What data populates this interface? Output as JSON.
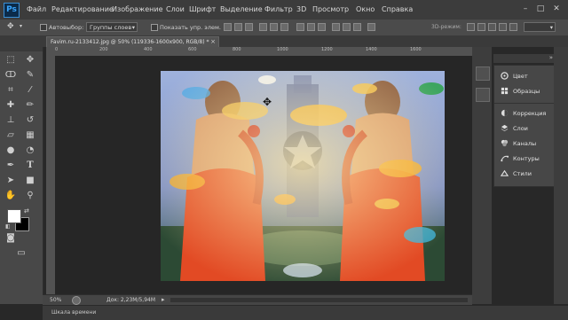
{
  "app": {
    "logo": "Ps",
    "menu": [
      "Файл",
      "Редактирование",
      "Изображение",
      "Слои",
      "Шрифт",
      "Выделение",
      "Фильтр",
      "3D",
      "Просмотр",
      "Окно",
      "Справка"
    ],
    "window_controls": [
      "minimize-icon",
      "maximize-icon",
      "close-icon"
    ]
  },
  "options_bar": {
    "auto_select_label": "Автовыбор:",
    "auto_select_value": "Группы слоев",
    "show_transform_label": "Показать упр. элем.",
    "mode_3d_label": "3D-режим:"
  },
  "document": {
    "tab_title": "Favim.ru-2133412.jpg @ 50% (119336-1600x900, RGB/8) *",
    "ruler_numbers": [
      "0",
      "200",
      "400",
      "600",
      "800",
      "1000",
      "1200",
      "1400",
      "1600"
    ]
  },
  "toolbox": {
    "tools": [
      "move-tool-icon",
      "marquee-tool-icon",
      "lasso-tool-icon",
      "quick-select-tool-icon",
      "crop-tool-icon",
      "eyedropper-tool-icon",
      "spot-heal-tool-icon",
      "brush-tool-icon",
      "clone-stamp-tool-icon",
      "history-brush-tool-icon",
      "eraser-tool-icon",
      "gradient-tool-icon",
      "blur-tool-icon",
      "dodge-tool-icon",
      "pen-tool-icon",
      "type-tool-icon",
      "path-select-tool-icon",
      "shape-tool-icon",
      "hand-tool-icon",
      "zoom-tool-icon"
    ]
  },
  "status": {
    "zoom": "50%",
    "doc_size": "Док: 2,23M/5,94M",
    "timeline_label": "Шкала времени"
  },
  "panels": {
    "items": [
      {
        "label": "Цвет",
        "icon": "color-wheel-icon"
      },
      {
        "label": "Образцы",
        "icon": "swatches-icon"
      },
      {
        "label": "Коррекция",
        "icon": "adjustments-icon"
      },
      {
        "label": "Слои",
        "icon": "layers-icon"
      },
      {
        "label": "Каналы",
        "icon": "channels-icon"
      },
      {
        "label": "Контуры",
        "icon": "paths-icon"
      },
      {
        "label": "Стили",
        "icon": "styles-icon"
      }
    ]
  },
  "colors": {
    "foreground": "#ffffff",
    "background": "#000000",
    "ps_blue": "#39a6ff"
  }
}
